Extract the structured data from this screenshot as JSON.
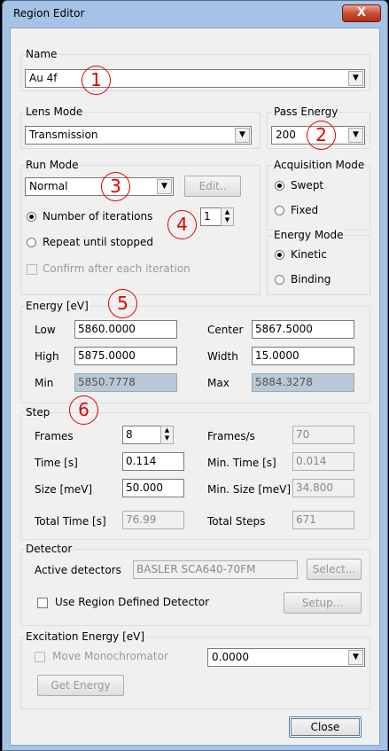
{
  "window": {
    "title": "Region Editor",
    "close_glyph": "X"
  },
  "name_group": {
    "label": "Name",
    "value": "Au 4f"
  },
  "lens_group": {
    "label": "Lens Mode",
    "value": "Transmission"
  },
  "pass_group": {
    "label": "Pass Energy",
    "value": "200"
  },
  "run_group": {
    "label": "Run Mode",
    "value": "Normal",
    "edit_button": "Edit..",
    "iterations_label": "Number of iterations",
    "iterations_value": "1",
    "repeat_label": "Repeat until stopped",
    "confirm_label": "Confirm after each iteration"
  },
  "acq_group": {
    "label": "Acquisition Mode",
    "swept": "Swept",
    "fixed": "Fixed"
  },
  "energy_mode_group": {
    "label": "Energy Mode",
    "kinetic": "Kinetic",
    "binding": "Binding"
  },
  "energy_group": {
    "label": "Energy [eV]",
    "low_label": "Low",
    "low_value": "5860.0000",
    "center_label": "Center",
    "center_value": "5867.5000",
    "high_label": "High",
    "high_value": "5875.0000",
    "width_label": "Width",
    "width_value": "15.0000",
    "min_label": "Min",
    "min_value": "5850.7778",
    "max_label": "Max",
    "max_value": "5884.3278"
  },
  "step_group": {
    "label": "Step",
    "frames_label": "Frames",
    "frames_value": "8",
    "frames_s_label": "Frames/s",
    "frames_s_value": "70",
    "time_label": "Time [s]",
    "time_value": "0.114",
    "min_time_label": "Min. Time [s]",
    "min_time_value": "0.014",
    "size_label": "Size [meV]",
    "size_value": "50.000",
    "min_size_label": "Min. Size [meV]",
    "min_size_value": "34.800",
    "total_time_label": "Total Time [s]",
    "total_time_value": "76.99",
    "total_steps_label": "Total Steps",
    "total_steps_value": "671"
  },
  "detector_group": {
    "label": "Detector",
    "active_label": "Active detectors",
    "active_value": "BASLER SCA640-70FM",
    "select_button": "Select...",
    "use_region_label": "Use Region Defined Detector",
    "setup_button": "Setup..."
  },
  "excitation_group": {
    "label": "Excitation Energy [eV]",
    "move_label": "Move Monochromator",
    "value": "0.0000",
    "get_energy_button": "Get Energy"
  },
  "footer": {
    "close_button": "Close"
  },
  "annotations": [
    "1",
    "2",
    "3",
    "4",
    "5",
    "6"
  ]
}
